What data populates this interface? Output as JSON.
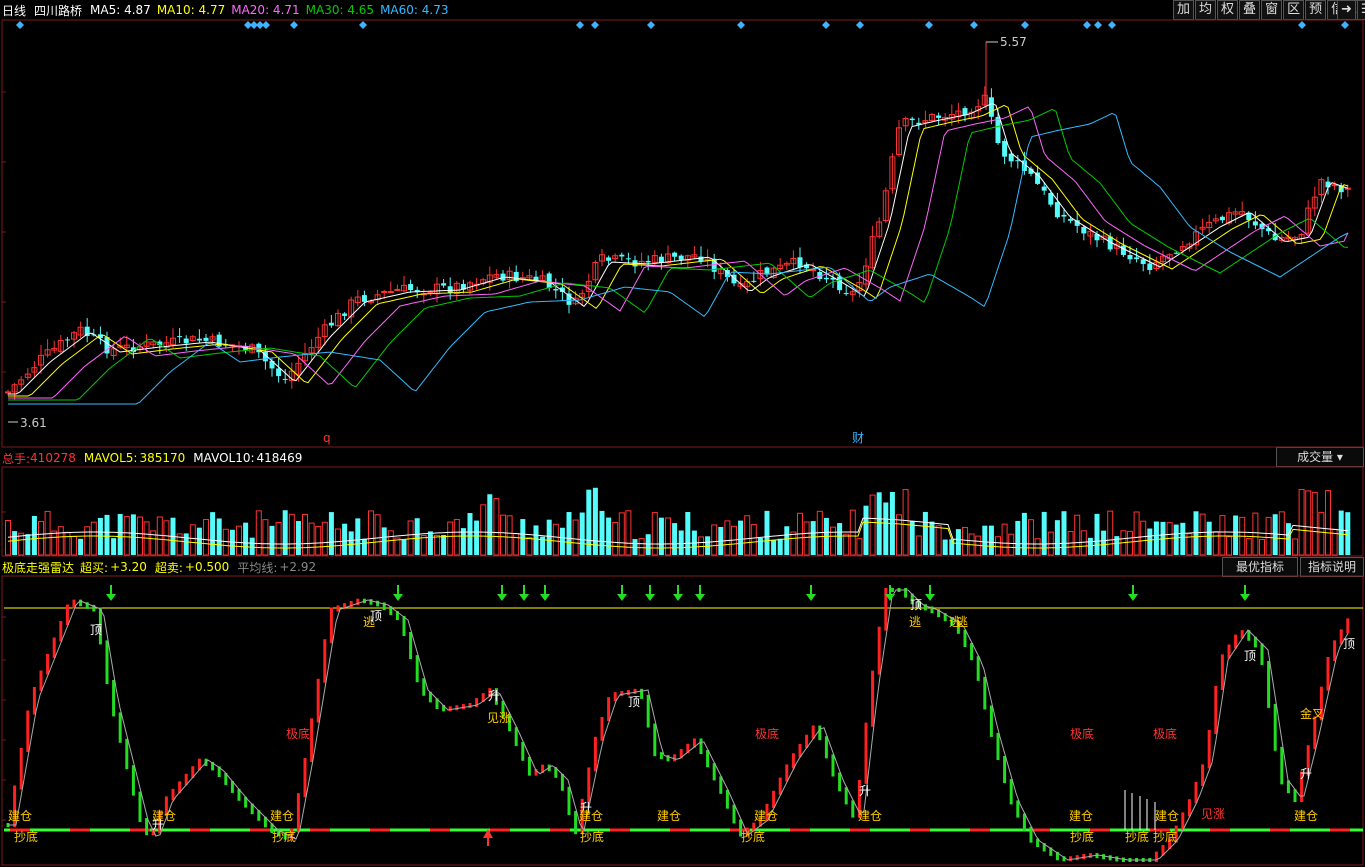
{
  "header": {
    "period": "日线",
    "stock_name": "四川路桥",
    "ma": [
      {
        "label": "MA5:",
        "value": "4.87",
        "color": "#ffffff"
      },
      {
        "label": "MA10:",
        "value": "4.77",
        "color": "#ffff00"
      },
      {
        "label": "MA20:",
        "value": "4.71",
        "color": "#ff66ff"
      },
      {
        "label": "MA30:",
        "value": "4.65",
        "color": "#00cc00"
      },
      {
        "label": "MA60:",
        "value": "4.73",
        "color": "#33bbff"
      }
    ],
    "toolbar": [
      "加",
      "均",
      "权",
      "叠",
      "窗",
      "区",
      "预",
      "信息"
    ]
  },
  "price_panel": {
    "high_label": "5.57",
    "low_label": "3.61",
    "marker_q": "q",
    "marker_cai": "财"
  },
  "volume_panel": {
    "total_label": "总手:",
    "total_value": "410278",
    "mavol5_label": "MAVOL5:",
    "mavol5_value": "385170",
    "mavol10_label": "MAVOL10:",
    "mavol10_value": "418469",
    "dropdown": "成交量"
  },
  "indicator_panel": {
    "name": "极底走强雷达",
    "overbuy_label": "超买:",
    "overbuy_value": "+3.20",
    "oversell_label": "超卖:",
    "oversell_value": "+0.500",
    "avg_label": "平均线:",
    "avg_value": "+2.92",
    "btn_best": "最优指标",
    "btn_help": "指标说明",
    "labels": {
      "jiancang": "建仓",
      "chaodi": "抄底",
      "ding": "顶",
      "tao": "逃",
      "sheng": "升",
      "jianzhang": "见涨",
      "jidi": "极底",
      "jincha": "金叉"
    }
  },
  "chart_data": {
    "type": "candlestick",
    "price_range": [
      3.61,
      5.57
    ],
    "ma_periods": [
      5,
      10,
      20,
      30,
      60
    ],
    "colors": {
      "up": "#ff3232",
      "down": "#54fcfc",
      "background": "#000000"
    }
  }
}
